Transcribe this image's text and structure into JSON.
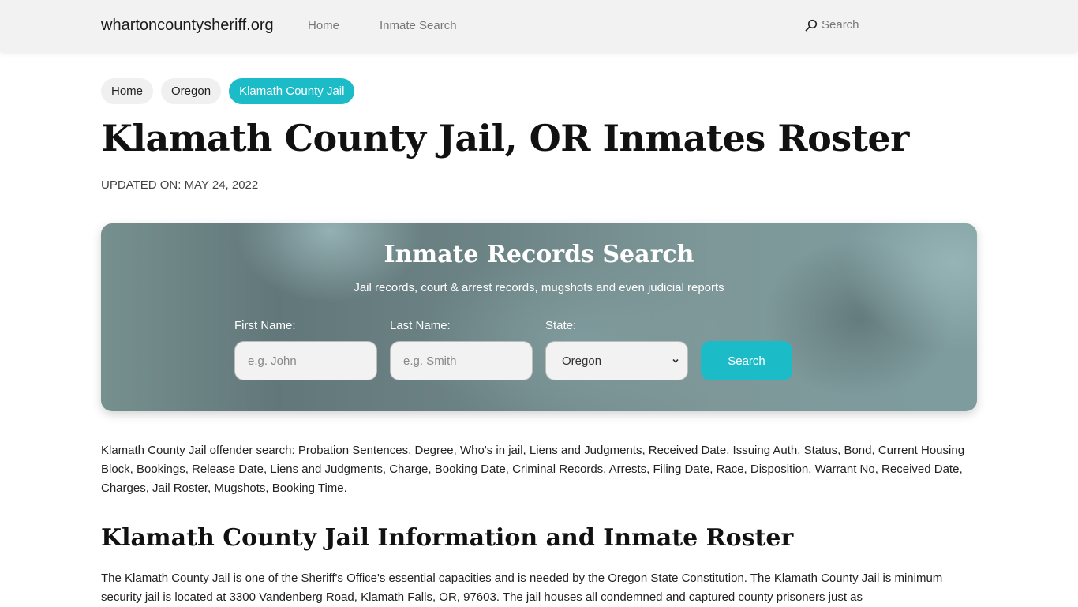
{
  "navbar": {
    "brand": "whartoncountysheriff.org",
    "links": [
      {
        "label": "Home"
      },
      {
        "label": "Inmate Search"
      }
    ],
    "search_label": "Search"
  },
  "breadcrumb": [
    {
      "label": "Home"
    },
    {
      "label": "Oregon"
    },
    {
      "label": "Klamath County Jail"
    }
  ],
  "page": {
    "title": "Klamath County Jail, OR Inmates Roster",
    "updated": "UPDATED ON: MAY 24, 2022"
  },
  "search_panel": {
    "title": "Inmate Records Search",
    "subtitle": "Jail records, court & arrest records, mugshots and even judicial reports",
    "first_name_label": "First Name:",
    "first_name_placeholder": "e.g. John",
    "last_name_label": "Last Name:",
    "last_name_placeholder": "e.g. Smith",
    "state_label": "State:",
    "state_value": "Oregon",
    "button_label": "Search"
  },
  "content": {
    "intro": "Klamath County Jail offender search: Probation Sentences, Degree, Who's in jail, Liens and Judgments, Received Date, Issuing Auth, Status, Bond, Current Housing Block, Bookings, Release Date, Liens and Judgments, Charge, Booking Date, Criminal Records, Arrests, Filing Date, Race, Disposition, Warrant No, Received Date, Charges, Jail Roster, Mugshots, Booking Time.",
    "section_title": "Klamath County Jail Information and Inmate Roster",
    "section_body": "The Klamath County Jail is one of the Sheriff's Office's essential capacities and is needed by the Oregon State Constitution. The Klamath County Jail is minimum security jail is located at 3300 Vandenberg Road, Klamath Falls, OR, 97603. The jail houses all condemned and captured county prisoners just as"
  },
  "colors": {
    "accent": "#1bbcc7",
    "navbar_bg": "#f2f2f2"
  }
}
